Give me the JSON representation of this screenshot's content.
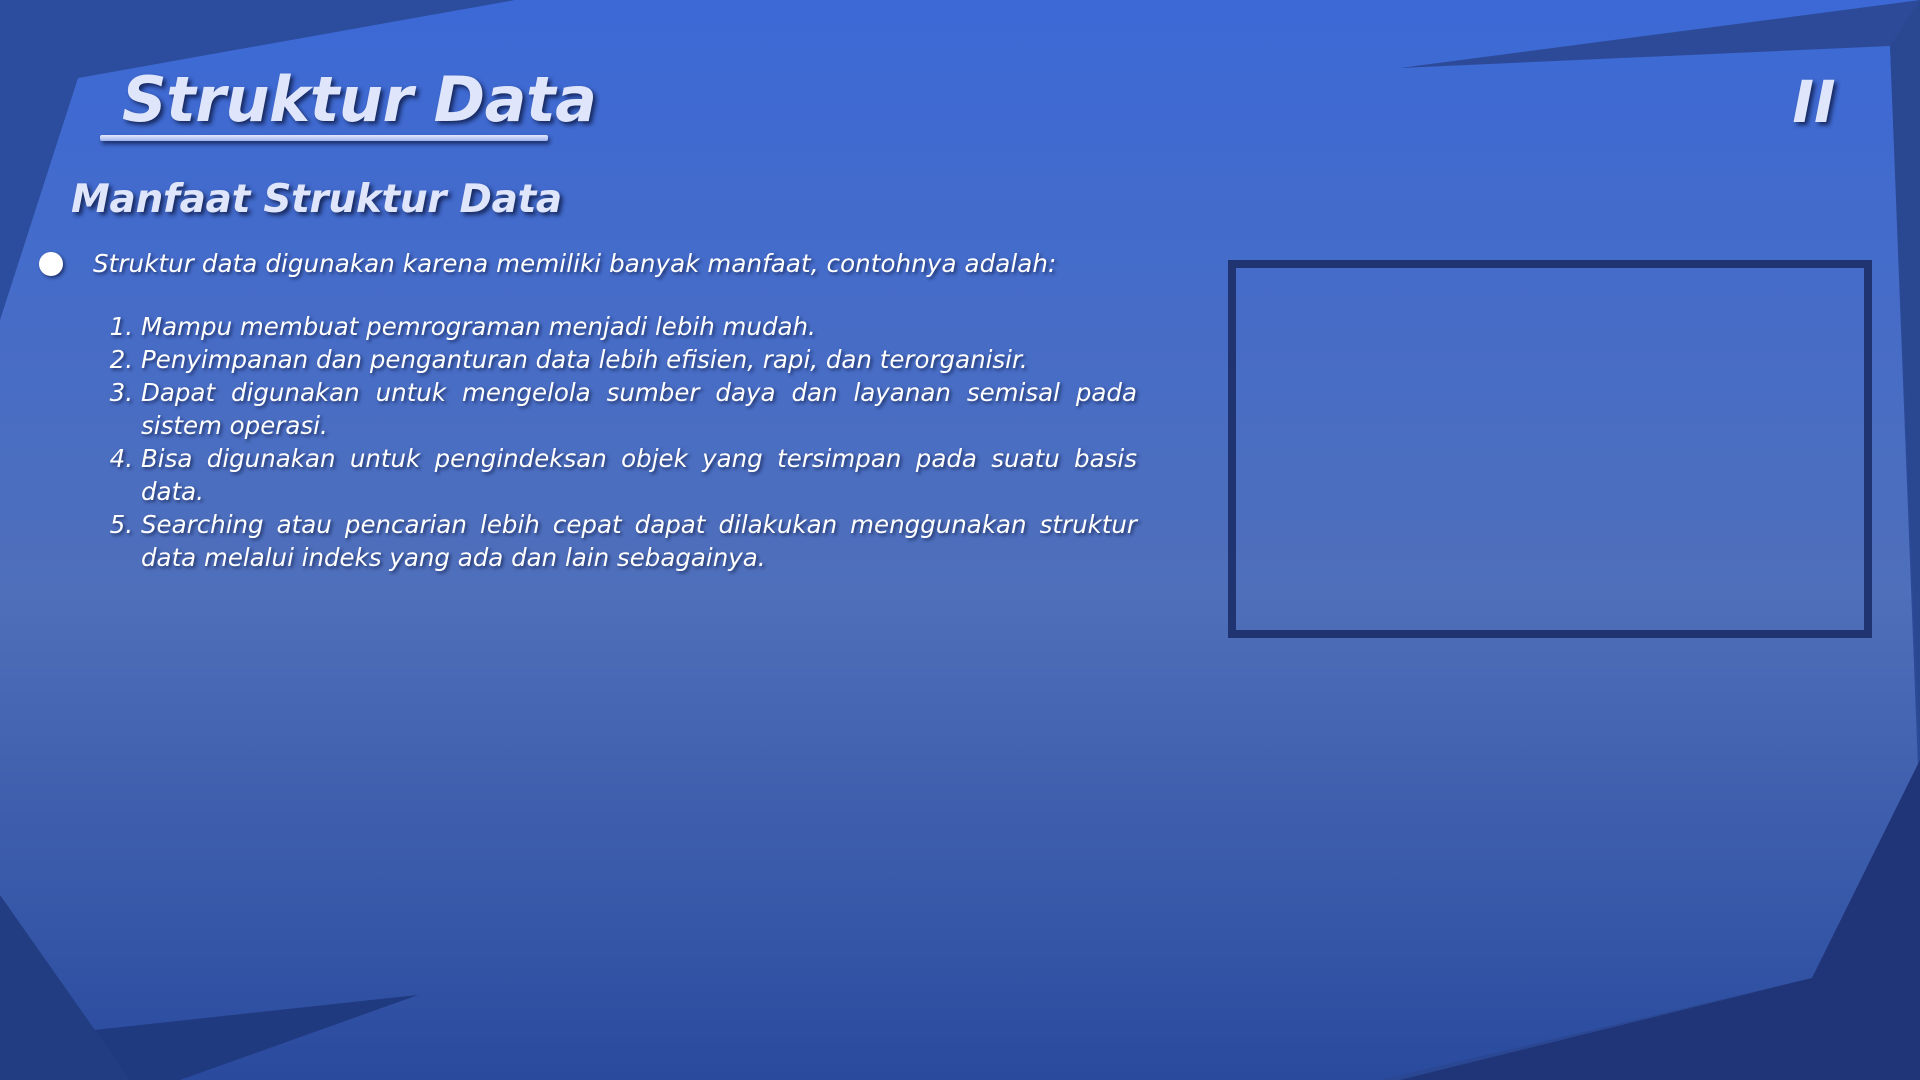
{
  "slide": {
    "title": "Struktur Data",
    "section_number": "II",
    "subtitle": "Manfaat Struktur Data",
    "intro": "Struktur data digunakan karena memiliki banyak manfaat, contohnya adalah:",
    "benefits": [
      {
        "number": "1.",
        "text": "Mampu membuat pemrograman menjadi lebih mudah."
      },
      {
        "number": "2.",
        "text": "Penyimpanan dan penganturan data lebih efisien, rapi, dan terorganisir."
      },
      {
        "number": "3.",
        "text": "Dapat digunakan untuk mengelola sumber daya dan layanan semisal pada sistem operasi."
      },
      {
        "number": "4.",
        "text": "Bisa digunakan untuk pengindeksan objek yang tersimpan pada suatu basis data."
      },
      {
        "number": "5.",
        "text": "Searching atau pencarian lebih cepat dapat dilakukan menggunakan struktur data melalui indeks yang ada dan lain sebagainya."
      }
    ]
  },
  "colors": {
    "background_top": "#3c69d6",
    "background_bottom": "#2a4a9e",
    "text": "#ffffff",
    "heading": "#dfe6fb",
    "frame_border": "#1f3470"
  }
}
